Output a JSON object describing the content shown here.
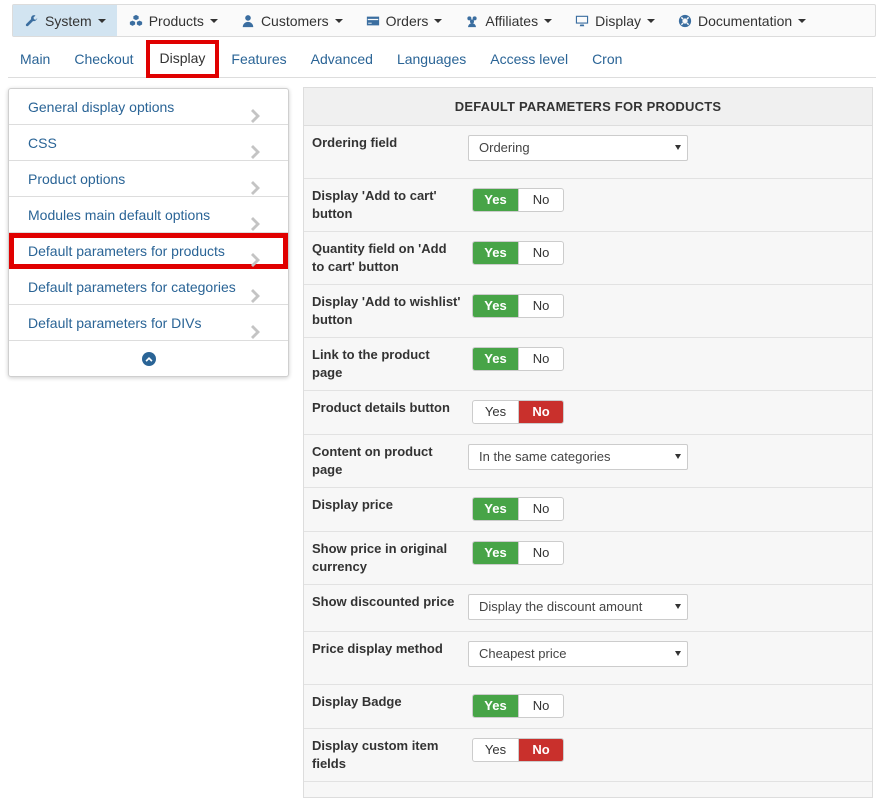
{
  "topnav": [
    {
      "label": "System",
      "icon": "wrench-icon",
      "active": true
    },
    {
      "label": "Products",
      "icon": "cubes-icon",
      "active": false
    },
    {
      "label": "Customers",
      "icon": "user-icon",
      "active": false
    },
    {
      "label": "Orders",
      "icon": "credit-card-icon",
      "active": false
    },
    {
      "label": "Affiliates",
      "icon": "users-icon",
      "active": false
    },
    {
      "label": "Display",
      "icon": "monitor-icon",
      "active": false
    },
    {
      "label": "Documentation",
      "icon": "lifebuoy-icon",
      "active": false
    }
  ],
  "subtabs": [
    {
      "label": "Main",
      "active": false
    },
    {
      "label": "Checkout",
      "active": false
    },
    {
      "label": "Display",
      "active": true
    },
    {
      "label": "Features",
      "active": false
    },
    {
      "label": "Advanced",
      "active": false
    },
    {
      "label": "Languages",
      "active": false
    },
    {
      "label": "Access level",
      "active": false
    },
    {
      "label": "Cron",
      "active": false
    }
  ],
  "sidemenu": [
    {
      "label": "General display options",
      "active": false
    },
    {
      "label": "CSS",
      "active": false
    },
    {
      "label": "Product options",
      "active": false
    },
    {
      "label": "Modules main default options",
      "active": false
    },
    {
      "label": "Default parameters for products",
      "active": true
    },
    {
      "label": "Default parameters for categories",
      "active": false
    },
    {
      "label": "Default parameters for DIVs",
      "active": false
    }
  ],
  "panel": {
    "title": "DEFAULT PARAMETERS FOR PRODUCTS",
    "rows": [
      {
        "label": "Ordering field",
        "type": "select",
        "value": "Ordering",
        "height": 53
      },
      {
        "label": "Display 'Add to cart' button",
        "type": "toggle",
        "value": "Yes",
        "height": 53
      },
      {
        "label": "Quantity field on 'Add to cart' button",
        "type": "toggle",
        "value": "Yes",
        "height": 53
      },
      {
        "label": "Display 'Add to wishlist' button",
        "type": "toggle",
        "value": "Yes",
        "height": 53
      },
      {
        "label": "Link to the product page",
        "type": "toggle",
        "value": "Yes",
        "height": 53
      },
      {
        "label": "Product details button",
        "type": "toggle",
        "value": "No",
        "height": 44
      },
      {
        "label": "Content on product page",
        "type": "select",
        "value": "In the same categories",
        "height": 53
      },
      {
        "label": "Display price",
        "type": "toggle",
        "value": "Yes",
        "height": 44
      },
      {
        "label": "Show price in original currency",
        "type": "toggle",
        "value": "Yes",
        "height": 53
      },
      {
        "label": "Show discounted price",
        "type": "select",
        "value": "Display the discount amount",
        "height": 47
      },
      {
        "label": "Price display method",
        "type": "select",
        "value": "Cheapest price",
        "height": 53
      },
      {
        "label": "Display Badge",
        "type": "toggle",
        "value": "Yes",
        "height": 44
      },
      {
        "label": "Display custom item fields",
        "type": "toggle",
        "value": "No",
        "height": 53
      }
    ],
    "yes_label": "Yes",
    "no_label": "No"
  },
  "colors": {
    "yes_active": "#47a447",
    "no_active": "#c9302c",
    "link": "#2a6496",
    "highlight": "#e00000"
  }
}
